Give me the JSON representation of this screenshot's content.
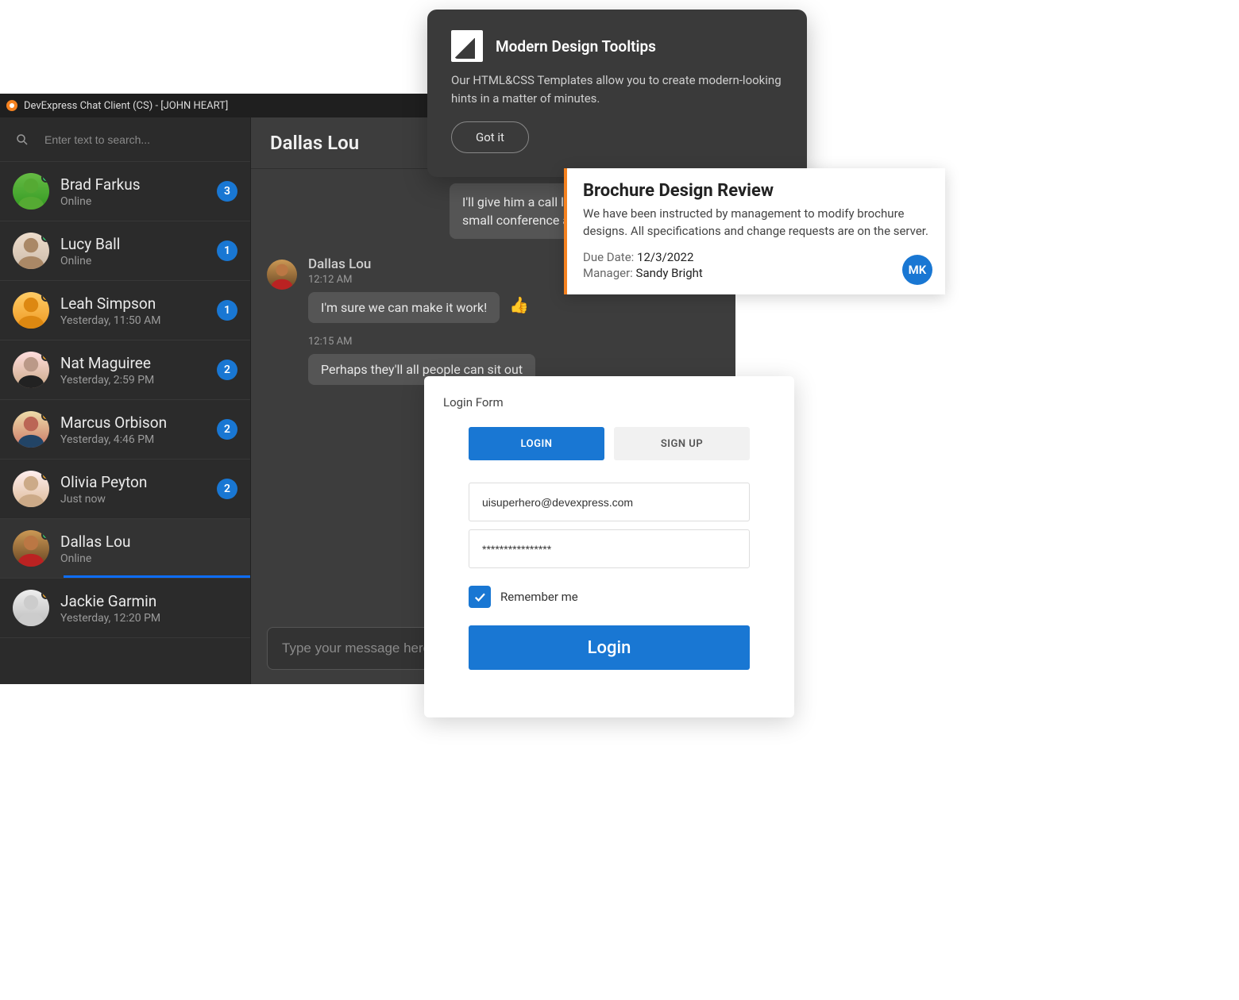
{
  "window": {
    "title": "DevExpress Chat Client (CS) - [JOHN HEART]"
  },
  "search": {
    "placeholder": "Enter text to search..."
  },
  "contacts": [
    {
      "name": "Brad Farkus",
      "sub": "Online",
      "badge": "3",
      "presence": "green"
    },
    {
      "name": "Lucy Ball",
      "sub": "Online",
      "badge": "1",
      "presence": "green"
    },
    {
      "name": "Leah Simpson",
      "sub": "Yesterday, 11:50 AM",
      "badge": "1",
      "presence": "orange"
    },
    {
      "name": "Nat Maguiree",
      "sub": "Yesterday, 2:59 PM",
      "badge": "2",
      "presence": "orange"
    },
    {
      "name": "Marcus Orbison",
      "sub": "Yesterday, 4:46 PM",
      "badge": "2",
      "presence": "orange"
    },
    {
      "name": "Olivia Peyton",
      "sub": "Just now",
      "badge": "2",
      "presence": "orange"
    },
    {
      "name": "Dallas Lou",
      "sub": "Online",
      "badge": "",
      "presence": "green"
    },
    {
      "name": "Jackie Garmin",
      "sub": "Yesterday, 12:20 PM",
      "badge": "",
      "presence": "orange"
    }
  ],
  "conversation": {
    "title": "Dallas Lou",
    "out_msg": "I'll give him a call later, but as I said, the small conference area",
    "sender": "Dallas Lou",
    "t1": "12:12 AM",
    "m1": "I'm sure we can make it work!",
    "t2": "12:15 AM",
    "m2": "Perhaps they'll all people can sit out",
    "composer_placeholder": "Type your message here..."
  },
  "dark_tip": {
    "title": "Modern Design Tooltips",
    "body": "Our HTML&CSS Templates allow you to create modern-looking hints in a matter of minutes.",
    "button": "Got it"
  },
  "white_card": {
    "title": "Brochure Design Review",
    "body": "We have been instructed by management to modify brochure designs. All specifications and change requests are on the server.",
    "due_label": "Due Date:",
    "due_value": "12/3/2022",
    "mgr_label": "Manager:",
    "mgr_value": "Sandy Bright",
    "initials": "MK"
  },
  "login": {
    "label": "Login Form",
    "tab_login": "LOGIN",
    "tab_signup": "SIGN UP",
    "email": "uisuperhero@devexpress.com",
    "password": "****************",
    "remember": "Remember me",
    "submit": "Login"
  }
}
